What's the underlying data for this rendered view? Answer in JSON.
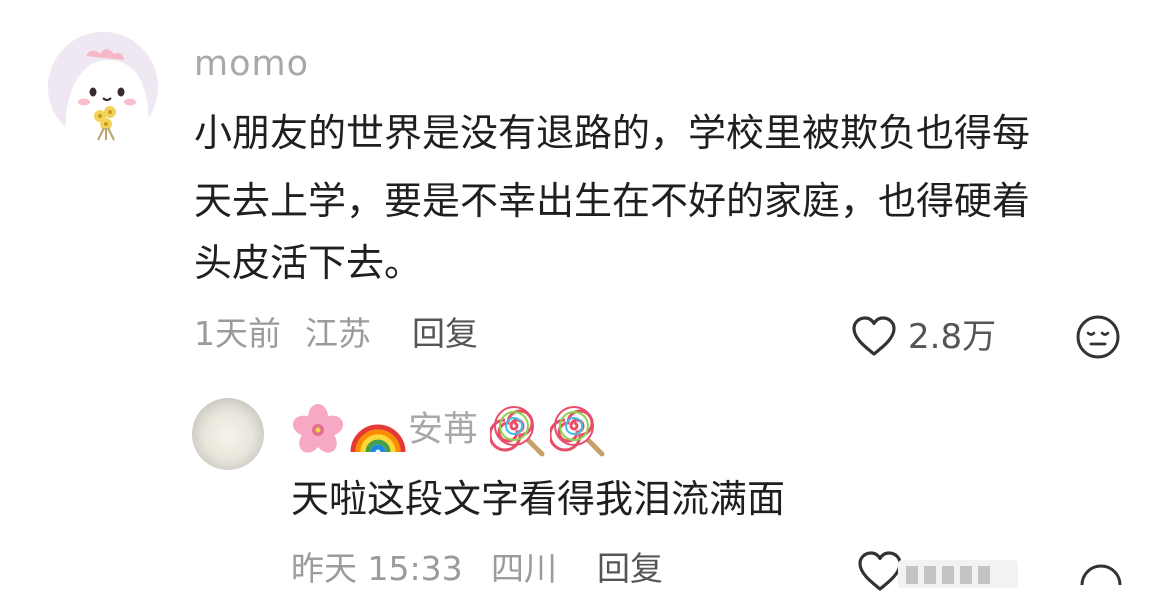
{
  "comment": {
    "username": "momo",
    "lines": [
      "小朋友的世界是没有退路的，学校里被欺负也得每",
      "天去上学，要是不幸出生在不好的家庭，也得硬着",
      "头皮活下去。"
    ],
    "time": "1天前",
    "location": "江苏",
    "reply_label": "回复",
    "likes": "2.8万"
  },
  "reply": {
    "username": "安苒",
    "text": "天啦这段文字看得我泪流满面",
    "time": "昨天 15:33",
    "location": "四川",
    "reply_label": "回复"
  },
  "icons": {
    "like": "heart-outline-icon",
    "dislike": "meh-face-icon",
    "name_decorations": [
      "cherry-blossom-emoji",
      "rainbow-emoji",
      "lollipop-emoji",
      "lollipop-emoji"
    ]
  }
}
